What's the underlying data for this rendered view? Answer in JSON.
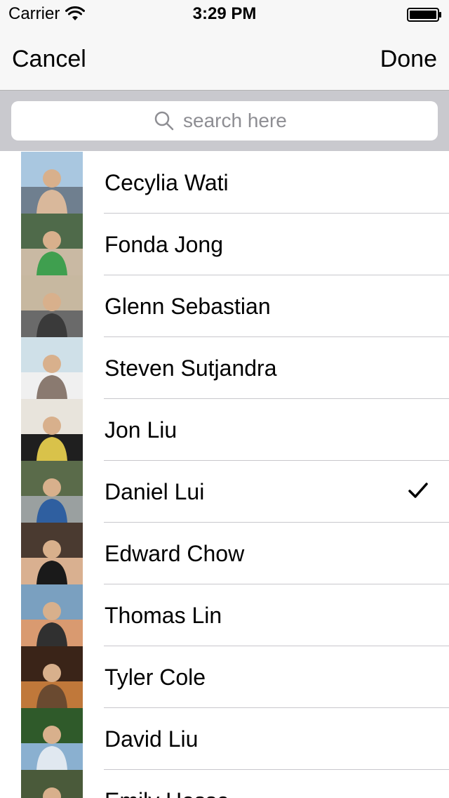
{
  "status_bar": {
    "carrier": "Carrier",
    "time": "3:29 PM",
    "icons": [
      "wifi-icon",
      "battery-icon"
    ]
  },
  "nav": {
    "cancel_label": "Cancel",
    "done_label": "Done"
  },
  "search": {
    "placeholder": "search here",
    "value": "",
    "icon": "search-icon"
  },
  "contacts": [
    {
      "name": "Cecylia Wati",
      "selected": false,
      "colors": [
        "#a9c7e0",
        "#6f7f8f",
        "#d9b89b"
      ]
    },
    {
      "name": "Fonda Jong",
      "selected": false,
      "colors": [
        "#4f6a4a",
        "#c9b9a3",
        "#3f9f4f"
      ]
    },
    {
      "name": "Glenn Sebastian",
      "selected": false,
      "colors": [
        "#c7b8a0",
        "#6a6a6a",
        "#3a3a3a"
      ]
    },
    {
      "name": "Steven Sutjandra",
      "selected": false,
      "colors": [
        "#cfe0e8",
        "#f0f0f0",
        "#8a7a70"
      ]
    },
    {
      "name": "Jon Liu",
      "selected": false,
      "colors": [
        "#e8e4dc",
        "#1f1f1f",
        "#d9c24a"
      ]
    },
    {
      "name": "Daniel Lui",
      "selected": true,
      "colors": [
        "#5a6b4a",
        "#9aa0a0",
        "#2f5fa0"
      ]
    },
    {
      "name": "Edward Chow",
      "selected": false,
      "colors": [
        "#4a3a30",
        "#d9b090",
        "#1a1a1a"
      ]
    },
    {
      "name": "Thomas Lin",
      "selected": false,
      "colors": [
        "#7aa0c0",
        "#d99a70",
        "#303030"
      ]
    },
    {
      "name": "Tyler Cole",
      "selected": false,
      "colors": [
        "#3a2418",
        "#c0783a",
        "#6a4a30"
      ]
    },
    {
      "name": "David Liu",
      "selected": false,
      "colors": [
        "#2f5a2a",
        "#8ab0d0",
        "#e0e8f0"
      ]
    },
    {
      "name": "Emily Hesse",
      "selected": false,
      "colors": [
        "#4a5a3a",
        "#8a7060",
        "#a0b080"
      ]
    }
  ],
  "icons": {
    "selected_indicator": "checkmark-icon"
  }
}
